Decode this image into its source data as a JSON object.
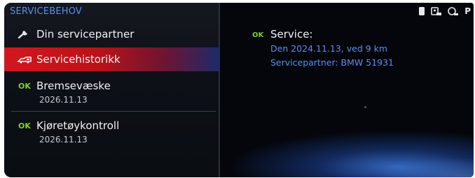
{
  "header": {
    "title": "SERVICEBEHOV"
  },
  "menu": {
    "partner": {
      "label": "Din servicepartner",
      "icon": "wrench-icon"
    },
    "history": {
      "label": "Servicehistorikk",
      "icon": "car-service-icon",
      "selected": true,
      "highlight_color": "#d4161e"
    },
    "brake": {
      "status": "OK",
      "label": "Bremsevæske",
      "date": "2026.11.13"
    },
    "vehicle": {
      "status": "OK",
      "label": "Kjøretøykontroll",
      "date": "2026.11.13"
    }
  },
  "detail": {
    "status": "OK",
    "title": "Service:",
    "date_line": "Den 2024.11.13, ved 9 km",
    "partner_line": "Servicepartner: BMW 51931"
  },
  "status_bar": {
    "icons": [
      "phone-icon",
      "network-icon",
      "car-connect-icon"
    ],
    "trailing_text": "P"
  },
  "colors": {
    "accent_blue": "#5d8fe6",
    "ok_green": "#7fd12a",
    "background": "#05070d"
  }
}
